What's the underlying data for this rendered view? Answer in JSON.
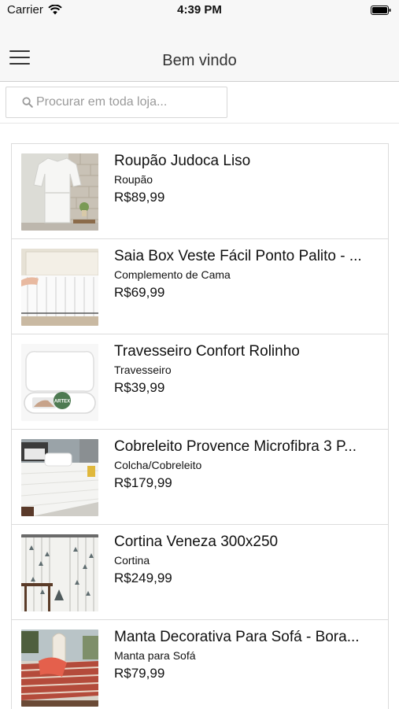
{
  "status_bar": {
    "carrier": "Carrier",
    "time": "4:39 PM"
  },
  "nav": {
    "title": "Bem vindo",
    "menu_icon": "hamburger-menu-icon"
  },
  "search": {
    "placeholder": "Procurar em toda loja...",
    "value": ""
  },
  "products": [
    {
      "name": "Roupão Judoca Liso",
      "category": "Roupão",
      "price": "R$89,99"
    },
    {
      "name": "Saia Box Veste Fácil Ponto Palito - ...",
      "category": "Complemento de Cama",
      "price": "R$69,99"
    },
    {
      "name": "Travesseiro Confort Rolinho",
      "category": "Travesseiro",
      "price": "R$39,99",
      "image_badge": "ARTEX"
    },
    {
      "name": "Cobreleito Provence Microfibra 3 P...",
      "category": "Colcha/Cobreleito",
      "price": "R$179,99"
    },
    {
      "name": "Cortina Veneza 300x250",
      "category": "Cortina",
      "price": "R$249,99"
    },
    {
      "name": "Manta Decorativa Para Sofá - Bora...",
      "category": "Manta para Sofá",
      "price": "R$79,99"
    }
  ]
}
